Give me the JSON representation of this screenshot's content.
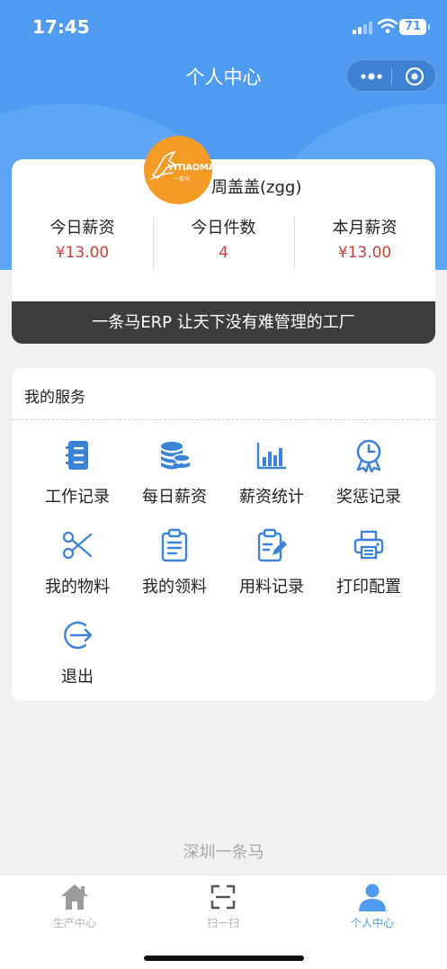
{
  "status_bar": {
    "time": "17:45",
    "battery": "71"
  },
  "nav": {
    "title": "个人中心"
  },
  "profile": {
    "logo_text": "YITIAOMA",
    "logo_sub": "一条马",
    "username": "周盖盖(zgg)",
    "stats": [
      {
        "label": "今日薪资",
        "value": "¥13.00"
      },
      {
        "label": "今日件数",
        "value": "4"
      },
      {
        "label": "本月薪资",
        "value": "¥13.00"
      }
    ],
    "slogan": "一条马ERP 让天下没有难管理的工厂"
  },
  "services": {
    "title": "我的服务",
    "items": [
      {
        "label": "工作记录",
        "icon": "notebook-icon"
      },
      {
        "label": "每日薪资",
        "icon": "coins-icon"
      },
      {
        "label": "薪资统计",
        "icon": "bar-chart-icon"
      },
      {
        "label": "奖惩记录",
        "icon": "award-clock-icon"
      },
      {
        "label": "我的物料",
        "icon": "scissors-icon"
      },
      {
        "label": "我的领料",
        "icon": "clipboard-list-icon"
      },
      {
        "label": "用料记录",
        "icon": "clipboard-edit-icon"
      },
      {
        "label": "打印配置",
        "icon": "printer-icon"
      },
      {
        "label": "退出",
        "icon": "logout-icon"
      }
    ]
  },
  "footer": {
    "company": "深圳一条马"
  },
  "tabbar": {
    "tabs": [
      {
        "label": "生产中心",
        "icon": "home-icon",
        "active": false
      },
      {
        "label": "扫一扫",
        "icon": "scan-icon",
        "active": false
      },
      {
        "label": "个人中心",
        "icon": "person-icon",
        "active": true
      }
    ]
  },
  "colors": {
    "primary": "#4f9bf1",
    "accent_red": "#c7423a",
    "avatar_orange": "#f39a27",
    "slogan_bg": "#3d3d3f"
  }
}
